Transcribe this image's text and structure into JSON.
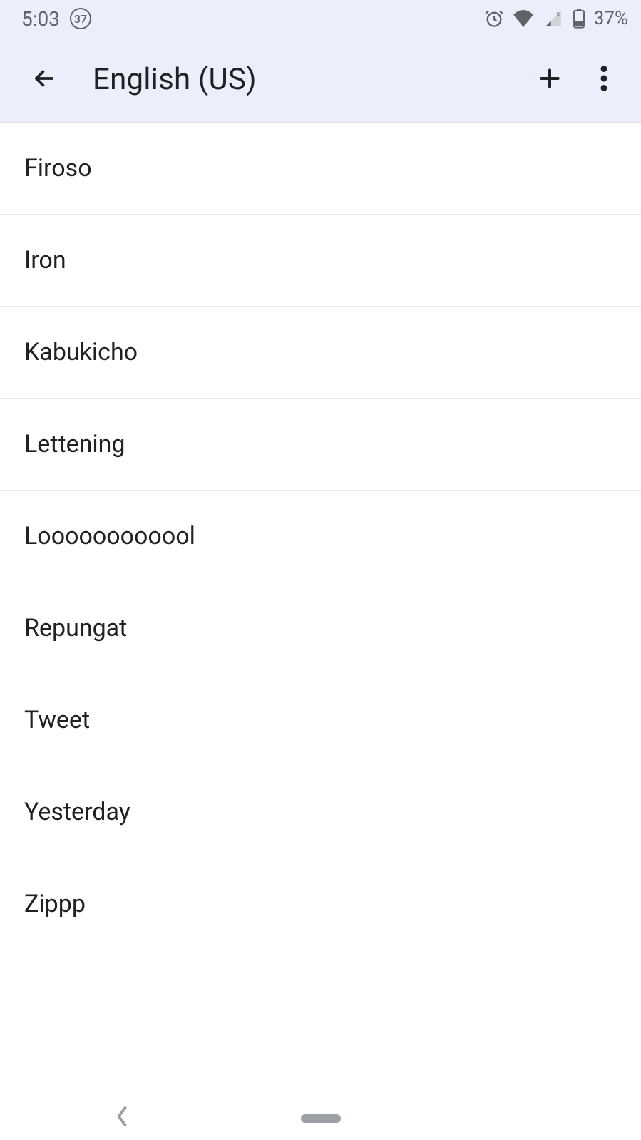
{
  "status": {
    "time": "5:03",
    "badge": "37",
    "battery_pct": "37%"
  },
  "appbar": {
    "title": "English (US)"
  },
  "words": [
    "Firoso",
    "Iron",
    "Kabukicho",
    "Lettening",
    "Loooooooooool",
    "Repungat",
    "Tweet",
    "Yesterday",
    "Zippp"
  ]
}
